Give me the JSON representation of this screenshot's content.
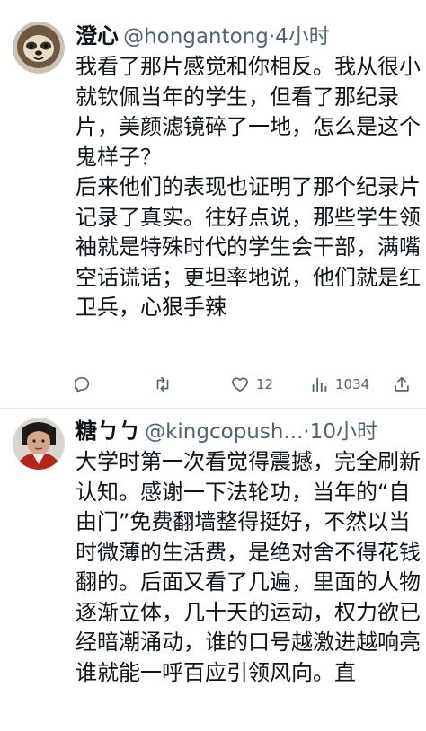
{
  "tweets": [
    {
      "name": "澄心",
      "handle": "@hongantong",
      "separator": "·",
      "time": "4小时",
      "text": "我看了那片感觉和你相反。我从很小就钦佩当年的学生，但看了那纪录片，美颜滤镜碎了一地，怎么是这个鬼样子？\n后来他们的表现也证明了那个纪录片记录了真实。往好点说，那些学生领袖就是特殊时代的学生会干部，满嘴空话谎话；更坦率地说，他们就是红卫兵，心狠手辣",
      "actions": {
        "reply_icon": "reply-icon",
        "retweet_icon": "retweet-icon",
        "like_icon": "heart-icon",
        "like_count": "12",
        "views_icon": "views-icon",
        "view_count": "1034",
        "share_icon": "share-icon"
      }
    },
    {
      "name": "糖ㄅㄅ",
      "handle": "@kingcopush...",
      "separator": "·",
      "time": "10小时",
      "text": "大学时第一次看觉得震撼，完全刷新认知。感谢一下法轮功，当年的“自由门”免费翻墙整得挺好，不然以当时微薄的生活费，是绝对舍不得花钱翻的。后面又看了几遍，里面的人物逐渐立体，几十天的运动，权力欲已经暗潮涌动，谁的口号越激进越响亮谁就能一呼百应引领风向。直"
    }
  ],
  "colors": {
    "text": "#0f1419",
    "secondary": "#536471",
    "divider": "#e6e9ec"
  }
}
